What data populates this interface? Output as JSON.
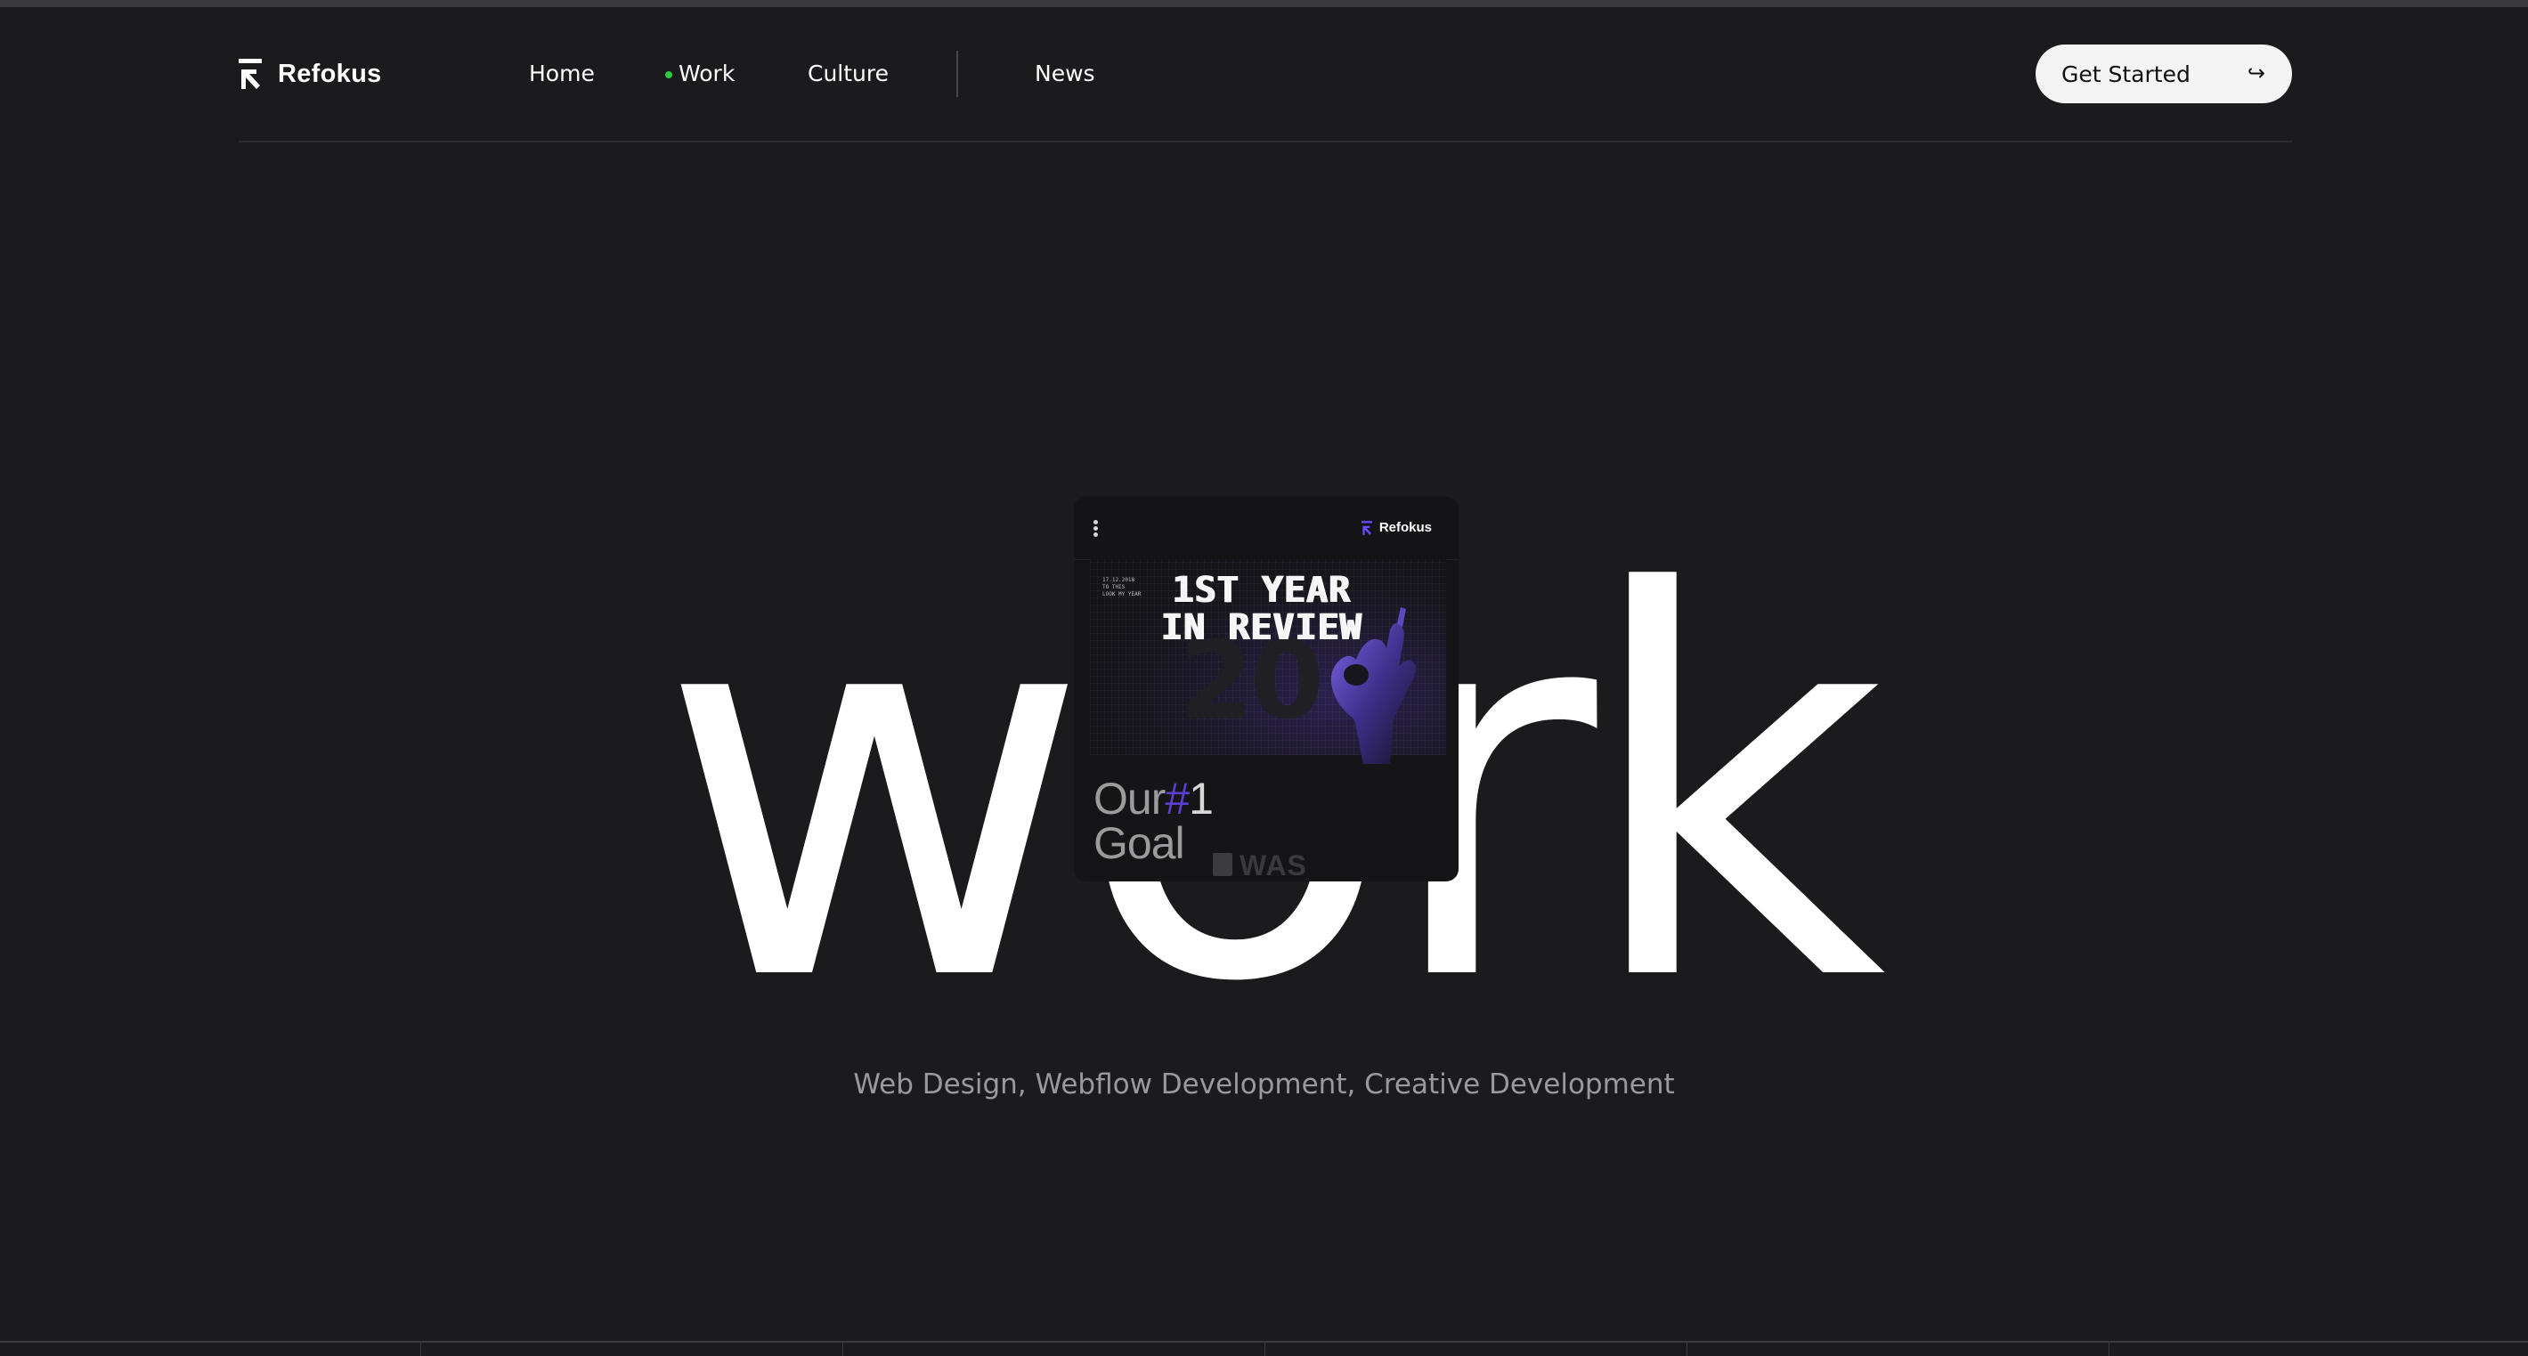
{
  "nav": {
    "brand": "Refokus",
    "links": [
      {
        "label": "Home"
      },
      {
        "label": "Work",
        "active": true
      },
      {
        "label": "Culture"
      },
      {
        "label": "News"
      }
    ],
    "cta_label": "Get Started",
    "cta_icon": "arrow-return-right-icon",
    "active_dot_color": "#2ecc40"
  },
  "hero": {
    "word": "work",
    "subtitle": "Web Design, Webflow Development, Creative Development"
  },
  "card": {
    "brand": "Refokus",
    "small_text": "17.12.2018\nTO THIS\nLOOK MY YEAR",
    "title_line1": "1ST YEAR",
    "title_line2": "IN REVIEW",
    "goal_line1_a": "Our",
    "goal_hash": "#",
    "goal_num": "1",
    "goal_line2": "Goal",
    "was_text": "WAS",
    "accent_color": "#5a3fd0"
  }
}
